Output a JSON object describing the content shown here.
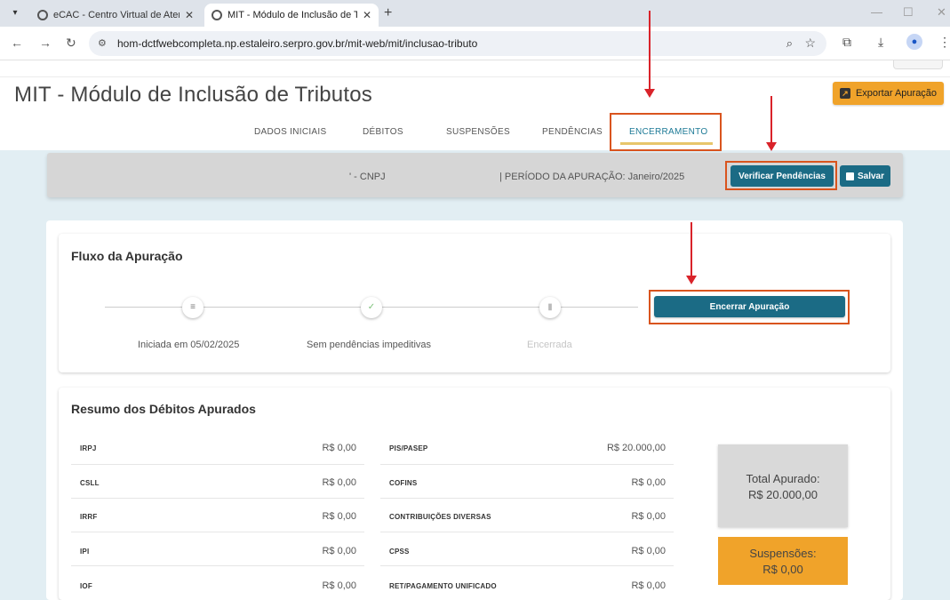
{
  "browser": {
    "tabs": [
      {
        "title": "eCAC - Centro Virtual de Atend",
        "active": false
      },
      {
        "title": "MIT - Módulo de Inclusão de Tr",
        "active": true
      }
    ],
    "url": "hom-dctfwebcompleta.np.estaleiro.serpro.gov.br/mit-web/mit/inclusao-tributo"
  },
  "header": {
    "title": "MIT - Módulo de Inclusão de Tributos",
    "export_label": "Exportar Apuração"
  },
  "nav": {
    "tabs": [
      "DADOS INICIAIS",
      "DÉBITOS",
      "SUSPENSÕES",
      "PENDÊNCIAS",
      "ENCERRAMENTO"
    ],
    "active": "ENCERRAMENTO"
  },
  "info_bar": {
    "cnpj": "' - CNPJ",
    "period": "| PERÍODO DA APURAÇÃO: Janeiro/2025",
    "verificar_label": "Verificar Pendências",
    "salvar_label": "Salvar"
  },
  "fluxo": {
    "title": "Fluxo da Apuração",
    "steps": [
      {
        "label": "Iniciada em 05/02/2025",
        "icon": "list-icon"
      },
      {
        "label": "Sem pendências impeditivas",
        "icon": "check-icon"
      },
      {
        "label": "Encerrada",
        "icon": "trash-icon"
      }
    ],
    "encerrar_label": "Encerrar Apuração"
  },
  "resumo": {
    "title": "Resumo dos Débitos Apurados",
    "left": [
      {
        "name": "IRPJ",
        "value": "R$ 0,00"
      },
      {
        "name": "CSLL",
        "value": "R$ 0,00"
      },
      {
        "name": "IRRF",
        "value": "R$ 0,00"
      },
      {
        "name": "IPI",
        "value": "R$ 0,00"
      },
      {
        "name": "IOF",
        "value": "R$ 0,00"
      }
    ],
    "right": [
      {
        "name": "PIS/PASEP",
        "value": "R$ 20.000,00"
      },
      {
        "name": "COFINS",
        "value": "R$ 0,00"
      },
      {
        "name": "CONTRIBUIÇÕES DIVERSAS",
        "value": "R$ 0,00"
      },
      {
        "name": "CPSS",
        "value": "R$ 0,00"
      },
      {
        "name": "RET/PAGAMENTO UNIFICADO",
        "value": "R$ 0,00"
      }
    ],
    "total_label": "Total Apurado:",
    "total_value": "R$ 20.000,00",
    "suspensoes_label": "Suspensões:",
    "suspensoes_value": "R$ 0,00"
  },
  "colors": {
    "primary": "#1b6b85",
    "accent": "#f0a32a",
    "annotation": "#d9232a"
  }
}
